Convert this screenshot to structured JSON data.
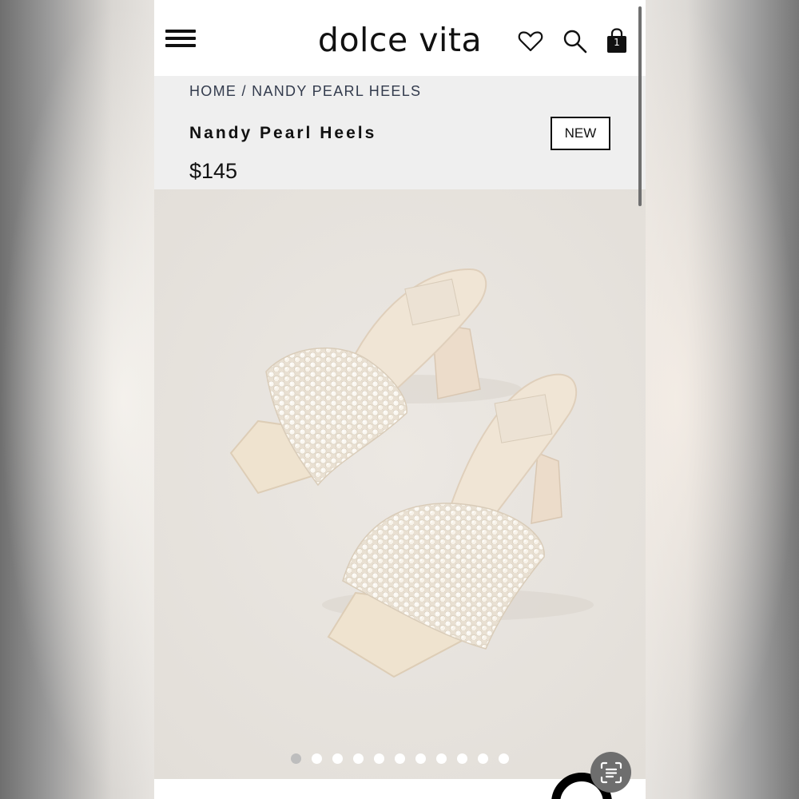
{
  "header": {
    "logo": "dolce vita",
    "icons": [
      "menu-icon",
      "heart-icon",
      "search-icon",
      "shopping-bag-icon"
    ],
    "bag_count": "1"
  },
  "breadcrumb": {
    "home": "HOME",
    "separator": "/",
    "current": "NANDY PEARL HEELS"
  },
  "product": {
    "name": "Nandy Pearl Heels",
    "badge": "NEW",
    "price": "$145"
  },
  "gallery": {
    "image_count": 11,
    "active_index": 0
  },
  "colors": {
    "brand_text": "#111111",
    "info_background": "#efefef",
    "photo_background": "#e7e3de",
    "sandal": "#efe4d2"
  }
}
